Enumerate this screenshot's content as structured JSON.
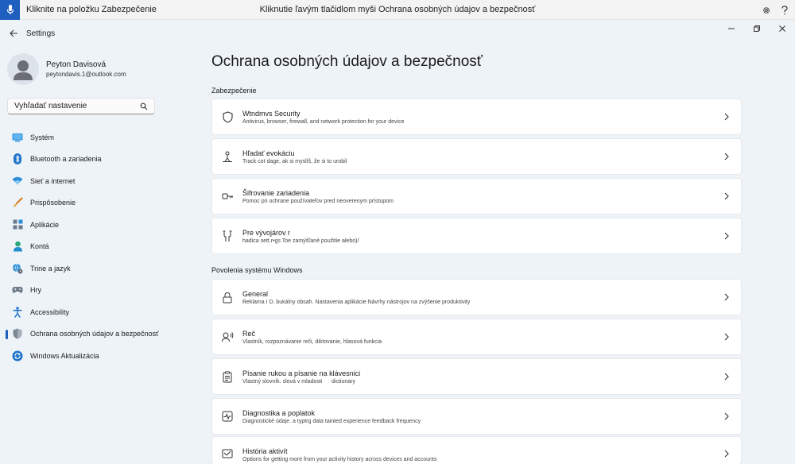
{
  "voice_bar": {
    "left_text": "Kliknite na položku Zabezpečenie",
    "center_text": "Kliknutie ľavým tlačidlom myši Ochrana osobných údajov a bezpečnosť"
  },
  "window": {
    "app_title": "Settings"
  },
  "profile": {
    "name": "Peyton Davisová",
    "email": "peytondavis.1@outlook.com"
  },
  "search": {
    "placeholder": "Vyhľadať nastavenie"
  },
  "sidebar": {
    "items": [
      {
        "label": "Systém",
        "icon": "system-icon"
      },
      {
        "label": "Bluetooth a zariadenia",
        "icon": "bluetooth-icon"
      },
      {
        "label": "Sieť a internet",
        "icon": "wifi-icon"
      },
      {
        "label": "Prispôsobenie",
        "icon": "brush-icon"
      },
      {
        "label": "Aplikácie",
        "icon": "apps-icon"
      },
      {
        "label": "Kontá",
        "icon": "account-icon"
      },
      {
        "label": "Trine a jazyk",
        "icon": "globe-clock-icon"
      },
      {
        "label": "Hry",
        "icon": "gamepad-icon"
      },
      {
        "label": "Accessibility",
        "icon": "accessibility-icon"
      },
      {
        "label": "Ochrana osobných údajov a bezpečnosť",
        "icon": "shield-icon"
      },
      {
        "label": "Windows Aktualizácia",
        "icon": "update-icon"
      }
    ]
  },
  "main": {
    "title": "Ochrana osobných údajov a bezpečnosť",
    "sections": [
      {
        "header": "Zabezpečenie",
        "cards": [
          {
            "title": "Wtndmvs Security",
            "subtitle": "Antivirus, browser, firewall, and network protection for your device",
            "icon": "shield-icon"
          },
          {
            "title": "Hľadať evokáciu",
            "subtitle": "Track cot dage, ak si myslíš, že si to urobil",
            "icon": "person-pin-icon"
          },
          {
            "title": "Šifrovanie zariadenia",
            "subtitle": "Pomoc pri ochrane používateľov pred neoverenym prístupom",
            "icon": "key-icon"
          },
          {
            "title": "Pre vývojárov r",
            "subtitle": "hadica sett.r•gs Toe zamýšľané použitie alebo)/",
            "icon": "developer-icon"
          }
        ]
      },
      {
        "header": "Povolenia systému Windows",
        "cards": [
          {
            "title": "General",
            "subtitle": "Reklama I D. bukálny obsah. Nastavenia aplikácie Návrhy nástrojov na zvýšenie produktivity",
            "icon": "lock-icon"
          },
          {
            "title": "Reč",
            "subtitle": "Vlastník, rozpoznávanie reči, diktovanie, hlasová funkcia",
            "icon": "speech-icon"
          },
          {
            "title": "Písanie rukou a písanie na klávesnici",
            "subtitle": "Vlastný slovník. slová v mladosti      dictionary",
            "icon": "clipboard-icon"
          },
          {
            "title": "Diagnostika a poplatok",
            "subtitle": "Diagnostické údaje. a typtrg data tainted experience feedback frequency",
            "icon": "diagnostics-icon"
          },
          {
            "title": "História aktivít",
            "subtitle": "Options for getting more from your activity history across devices and accounts",
            "icon": "history-icon"
          }
        ]
      }
    ]
  },
  "colors": {
    "accent": "#1f5fbf",
    "background": "#eef3f8",
    "card": "#ffffff"
  }
}
